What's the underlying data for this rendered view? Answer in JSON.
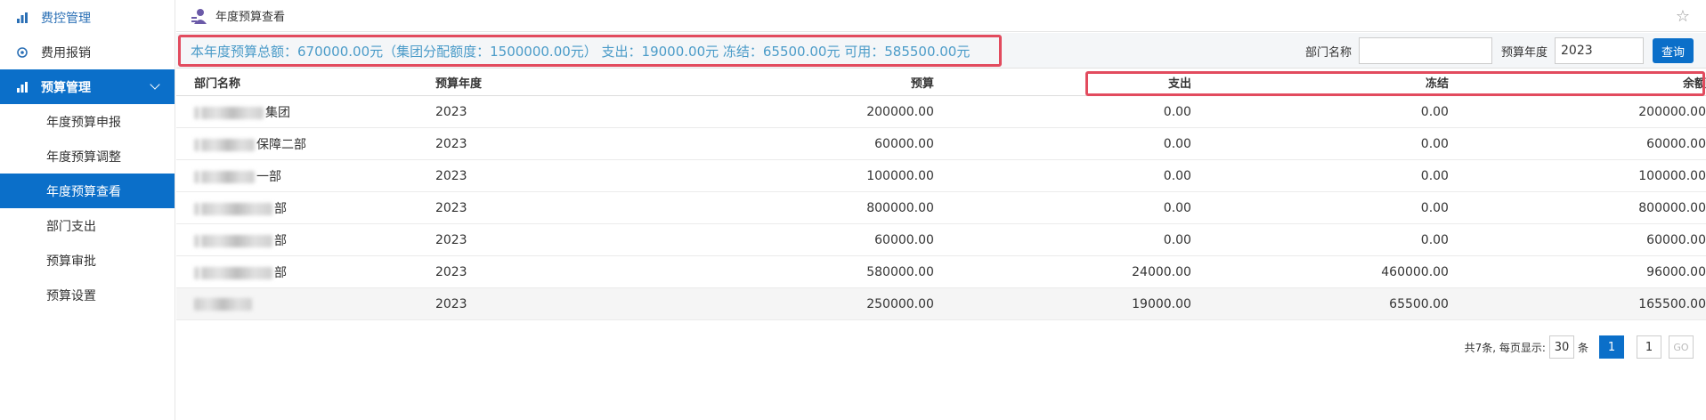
{
  "sidebar": {
    "groups": [
      {
        "label": "费控管理",
        "icon": "chart-icon"
      },
      {
        "label": "费用报销",
        "icon": "settings-icon"
      },
      {
        "label": "预算管理",
        "icon": "chart-icon"
      }
    ],
    "sub_items": [
      "年度预算申报",
      "年度预算调整",
      "年度预算查看",
      "部门支出",
      "预算审批",
      "预算设置"
    ],
    "active_sub_index": 2
  },
  "header": {
    "title": "年度预算查看",
    "star_icon": "star-icon"
  },
  "summary": {
    "text": "本年度预算总额：670000.00元（集团分配额度：1500000.00元） 支出：19000.00元 冻结：65500.00元 可用：585500.00元"
  },
  "filter": {
    "dept_label": "部门名称",
    "dept_value": "",
    "year_label": "预算年度",
    "year_value": "2023",
    "query_label": "查询"
  },
  "table": {
    "columns": [
      "部门名称",
      "预算年度",
      "预算",
      "支出",
      "冻结",
      "余额"
    ],
    "rows": [
      {
        "name_suffix": "集团",
        "year": "2023",
        "budget": "200000.00",
        "spend": "0.00",
        "frozen": "0.00",
        "balance": "200000.00"
      },
      {
        "name_suffix": "保障二部",
        "year": "2023",
        "budget": "60000.00",
        "spend": "0.00",
        "frozen": "0.00",
        "balance": "60000.00"
      },
      {
        "name_suffix": "一部",
        "year": "2023",
        "budget": "100000.00",
        "spend": "0.00",
        "frozen": "0.00",
        "balance": "100000.00"
      },
      {
        "name_suffix": "部",
        "year": "2023",
        "budget": "800000.00",
        "spend": "0.00",
        "frozen": "0.00",
        "balance": "800000.00"
      },
      {
        "name_suffix": "部",
        "year": "2023",
        "budget": "60000.00",
        "spend": "0.00",
        "frozen": "0.00",
        "balance": "60000.00"
      },
      {
        "name_suffix": "部",
        "year": "2023",
        "budget": "580000.00",
        "spend": "24000.00",
        "frozen": "460000.00",
        "balance": "96000.00"
      },
      {
        "name_suffix": "",
        "year": "2023",
        "budget": "250000.00",
        "spend": "19000.00",
        "frozen": "65500.00",
        "balance": "165500.00"
      }
    ]
  },
  "pager": {
    "total_text": "共7条, 每页显示:",
    "page_size": "30",
    "unit": "条",
    "current_page": "1",
    "jump_value": "1",
    "go_label": "GO"
  },
  "colors": {
    "accent": "#0b6fc9",
    "highlight": "#e24b5e",
    "summary_text": "#4a9bc8"
  }
}
